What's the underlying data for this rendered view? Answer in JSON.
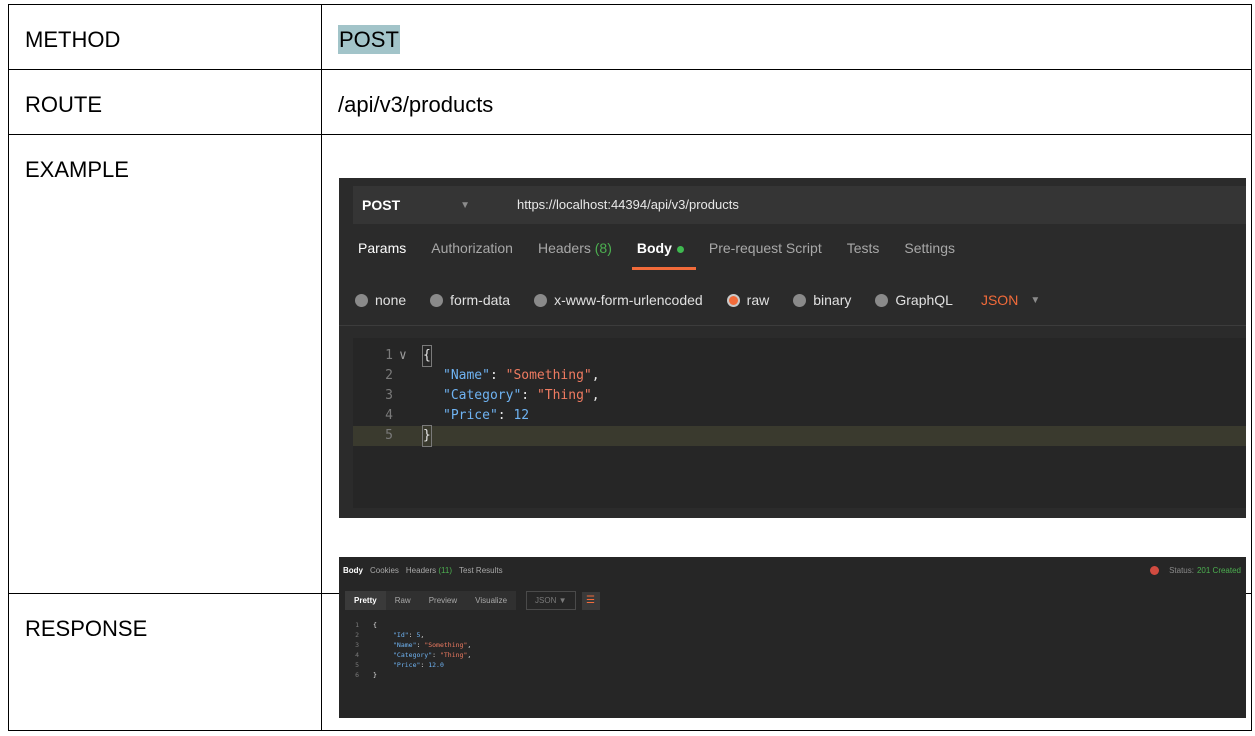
{
  "table": {
    "method_label": "METHOD",
    "method_value": "POST",
    "route_label": "ROUTE",
    "route_value": "/api/v3/products",
    "example_label": "EXAMPLE",
    "response_label": "RESPONSE"
  },
  "request": {
    "method": "POST",
    "url": "https://localhost:44394/api/v3/products",
    "tabs": [
      "Params",
      "Authorization",
      "Headers",
      "(8)",
      "Body",
      "Pre-request Script",
      "Tests",
      "Settings"
    ],
    "body_options": [
      "none",
      "form-data",
      "x-www-form-urlencoded",
      "raw",
      "binary",
      "GraphQL"
    ],
    "format": "JSON",
    "lines": [
      "1",
      "2",
      "3",
      "4",
      "5"
    ],
    "code": {
      "open": "{",
      "k1": "\"Name\"",
      "v1": "\"Something\"",
      "k2": "\"Category\"",
      "v2": "\"Thing\"",
      "k3": "\"Price\"",
      "v3": "12",
      "close": "}"
    }
  },
  "response": {
    "tabs": [
      "Body",
      "Cookies",
      "Headers",
      "(11)",
      "Test Results"
    ],
    "status_label": "Status:",
    "status_value": "201 Created",
    "views": [
      "Pretty",
      "Raw",
      "Preview",
      "Visualize"
    ],
    "format": "JSON",
    "lines": [
      "1",
      "2",
      "3",
      "4",
      "5",
      "6"
    ],
    "code": {
      "open": "{",
      "k1": "\"Id\"",
      "v1": "5",
      "k2": "\"Name\"",
      "v2": "\"Something\"",
      "k3": "\"Category\"",
      "v3": "\"Thing\"",
      "k4": "\"Price\"",
      "v4": "12.0",
      "close": "}"
    }
  },
  "colors": {
    "method_highlight": "#a2c4c9",
    "accent": "#f26b3a",
    "success": "#4caf50",
    "json_key": "#6fb3f2",
    "json_string": "#ef7b61"
  }
}
